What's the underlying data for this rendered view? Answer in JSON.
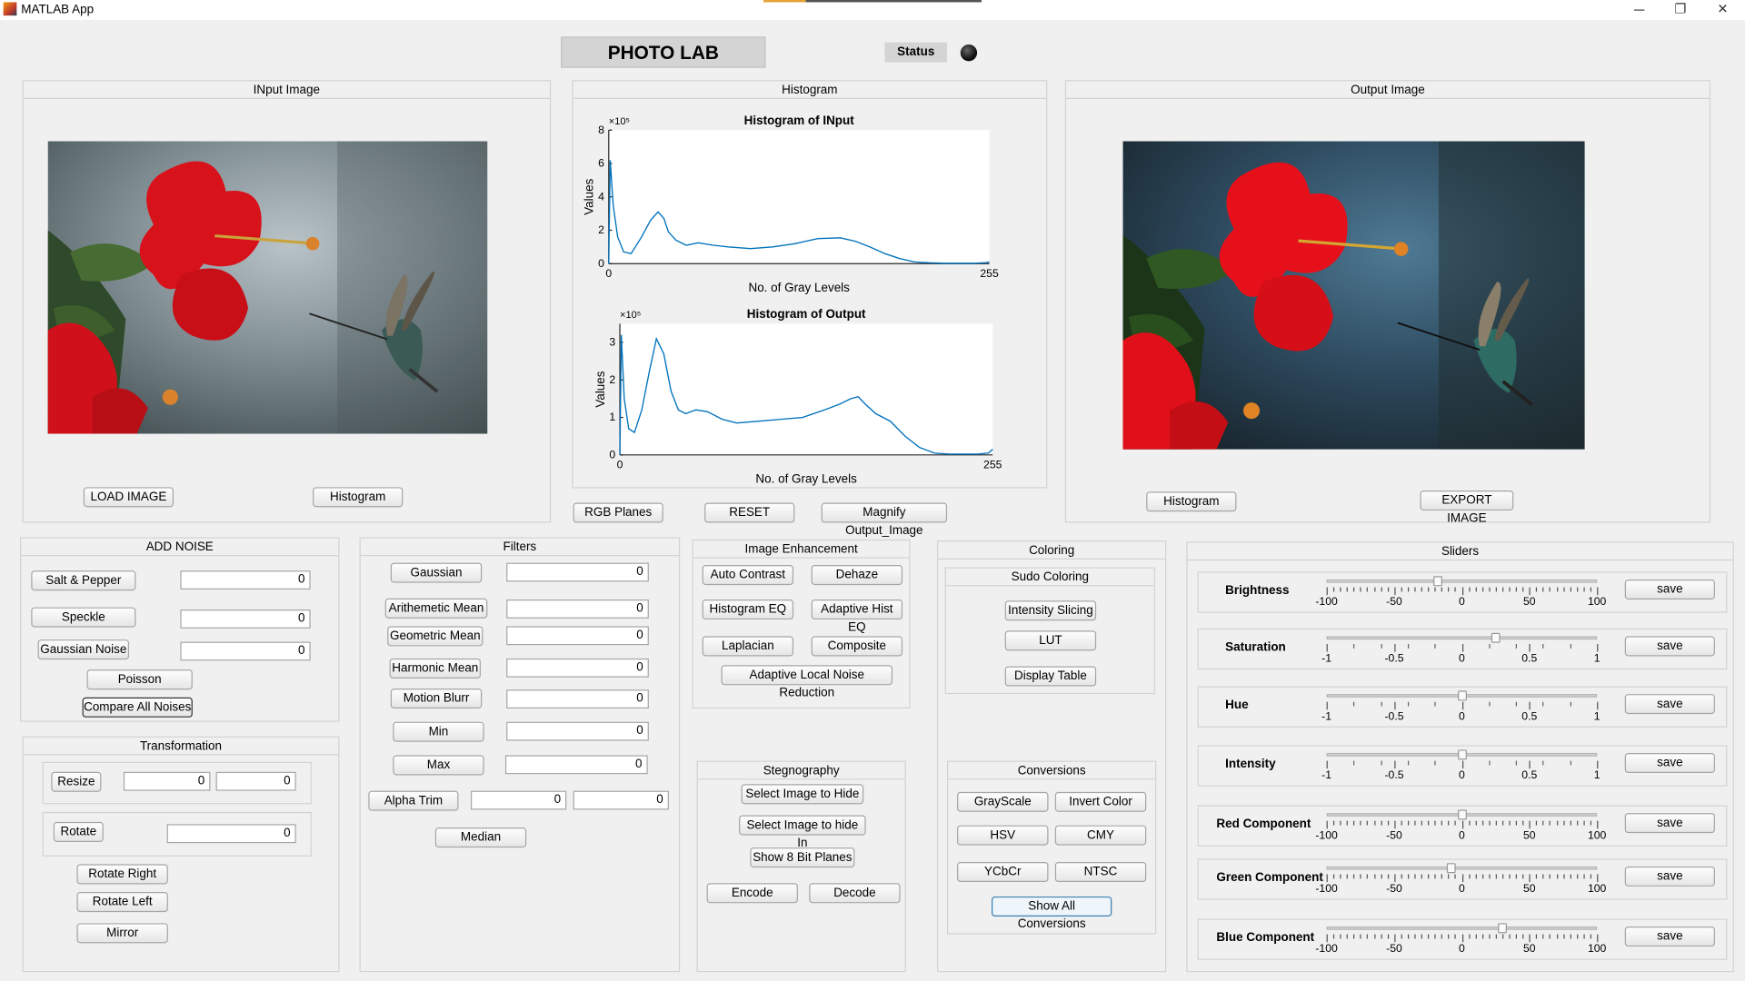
{
  "window": {
    "title": "MATLAB App",
    "minimize_glyph": "─",
    "maximize_glyph": "❐",
    "close_glyph": "✕"
  },
  "header": {
    "title": "PHOTO LAB",
    "status_label": "Status"
  },
  "input_panel": {
    "title": "INput Image",
    "load_button": "LOAD IMAGE",
    "histogram_button": "Histogram"
  },
  "output_panel": {
    "title": "Output Image",
    "histogram_button": "Histogram",
    "export_button": "EXPORT IMAGE"
  },
  "histogram_panel": {
    "title": "Histogram",
    "rgb_button": "RGB Planes",
    "reset_button": "RESET",
    "magnify_button": "Magnify Output_Image"
  },
  "chart_data": [
    {
      "type": "line",
      "title": "Histogram of INput",
      "xlabel": "No. of Gray Levels",
      "ylabel": "Values",
      "exponent_label": "×10⁵",
      "xlim": [
        0,
        255
      ],
      "ylim": [
        0,
        8
      ],
      "xticks": [
        "0",
        "255"
      ],
      "yticks": [
        "0",
        "2",
        "4",
        "6",
        "8"
      ],
      "series": [
        {
          "color": "#0072bd",
          "x": [
            0,
            1,
            3,
            6,
            10,
            15,
            22,
            28,
            33,
            37,
            40,
            45,
            52,
            60,
            70,
            80,
            95,
            110,
            125,
            140,
            155,
            165,
            175,
            185,
            195,
            205,
            215,
            225,
            235,
            245,
            252,
            255
          ],
          "y": [
            0,
            6.2,
            3.5,
            1.6,
            0.7,
            0.6,
            1.6,
            2.6,
            3.1,
            2.7,
            1.9,
            1.4,
            1.1,
            1.25,
            1.1,
            1.0,
            0.9,
            1.0,
            1.2,
            1.5,
            1.55,
            1.35,
            1.0,
            0.6,
            0.3,
            0.1,
            0.05,
            0.02,
            0.02,
            0.02,
            0.05,
            0.1
          ]
        }
      ]
    },
    {
      "type": "line",
      "title": "Histogram of Output",
      "xlabel": "No. of Gray Levels",
      "ylabel": "Values",
      "exponent_label": "×10⁵",
      "xlim": [
        0,
        255
      ],
      "ylim": [
        0,
        3.5
      ],
      "xticks": [
        "0",
        "255"
      ],
      "yticks": [
        "0",
        "1",
        "2",
        "3"
      ],
      "series": [
        {
          "color": "#0072bd",
          "x": [
            0,
            1,
            3,
            6,
            10,
            15,
            20,
            25,
            30,
            35,
            40,
            45,
            52,
            60,
            70,
            80,
            95,
            110,
            125,
            140,
            150,
            158,
            163,
            168,
            175,
            185,
            195,
            205,
            215,
            225,
            235,
            245,
            252,
            255
          ],
          "y": [
            0,
            3.2,
            1.5,
            0.7,
            0.6,
            1.2,
            2.2,
            3.1,
            2.7,
            1.7,
            1.2,
            1.1,
            1.2,
            1.15,
            0.95,
            0.85,
            0.9,
            0.95,
            1.0,
            1.2,
            1.35,
            1.5,
            1.55,
            1.35,
            1.1,
            0.9,
            0.5,
            0.2,
            0.05,
            0.02,
            0.02,
            0.02,
            0.05,
            0.15
          ]
        }
      ]
    }
  ],
  "add_noise": {
    "title": "ADD NOISE",
    "salt_pepper": "Salt & Pepper",
    "salt_pepper_value": "0",
    "speckle": "Speckle",
    "speckle_value": "0",
    "gaussian": "Gaussian Noise",
    "gaussian_value": "0",
    "poisson": "Poisson",
    "compare": "Compare All Noises"
  },
  "transformation": {
    "title": "Transformation",
    "resize": "Resize",
    "resize_w": "0",
    "resize_h": "0",
    "rotate": "Rotate",
    "rotate_value": "0",
    "rotate_right": "Rotate Right",
    "rotate_left": "Rotate Left",
    "mirror": "Mirror"
  },
  "filters": {
    "title": "Filters",
    "gaussian": "Gaussian",
    "gaussian_value": "0",
    "arith": "Arithemetic Mean",
    "arith_value": "0",
    "geo": "Geometric Mean",
    "geo_value": "0",
    "harm": "Harmonic Mean",
    "harm_value": "0",
    "motion": "Motion Blurr",
    "motion_value": "0",
    "min": "Min",
    "min_value": "0",
    "max": "Max",
    "max_value": "0",
    "alpha": "Alpha Trim",
    "alpha_value1": "0",
    "alpha_value2": "0",
    "median": "Median"
  },
  "enhancement": {
    "title": "Image Enhancement",
    "auto_contrast": "Auto Contrast",
    "dehaze": "Dehaze",
    "hist_eq": "Histogram EQ",
    "adapt_hist": "Adaptive Hist EQ",
    "laplacian": "Laplacian",
    "composite": "Composite",
    "adaptive_noise": "Adaptive Local Noise Reduction"
  },
  "steg": {
    "title": "Stegnography",
    "select_hide": "Select Image to Hide",
    "select_in": "Select Image to hide In",
    "show_planes": "Show 8 Bit Planes",
    "encode": "Encode",
    "decode": "Decode"
  },
  "coloring": {
    "title": "Coloring",
    "sudo_title": "Sudo Coloring",
    "intensity_slicing": "Intensity Slicing",
    "lut": "LUT",
    "display_table": "Display Table"
  },
  "conversions": {
    "title": "Conversions",
    "grayscale": "GrayScale",
    "invert": "Invert Color",
    "hsv": "HSV",
    "cmy": "CMY",
    "ycbcr": "YCbCr",
    "ntsc": "NTSC",
    "show_all": "Show All Conversions"
  },
  "sliders": {
    "title": "Sliders",
    "save_label": "save",
    "items": [
      {
        "label": "Brightness",
        "min": -100,
        "max": 100,
        "value": -18,
        "ticks": [
          "-100",
          "-50",
          "0",
          "50",
          "100"
        ],
        "minor": true
      },
      {
        "label": "Saturation",
        "min": -1,
        "max": 1,
        "value": 0.25,
        "ticks": [
          "-1",
          "-0.5",
          "0",
          "0.5",
          "1"
        ],
        "minor": false
      },
      {
        "label": "Hue",
        "min": -1,
        "max": 1,
        "value": 0,
        "ticks": [
          "-1",
          "-0.5",
          "0",
          "0.5",
          "1"
        ],
        "minor": false
      },
      {
        "label": "Intensity",
        "min": -1,
        "max": 1,
        "value": 0,
        "ticks": [
          "-1",
          "-0.5",
          "0",
          "0.5",
          "1"
        ],
        "minor": false
      },
      {
        "label": "Red Component",
        "min": -100,
        "max": 100,
        "value": 0,
        "ticks": [
          "-100",
          "-50",
          "0",
          "50",
          "100"
        ],
        "minor": true
      },
      {
        "label": "Green Component",
        "min": -100,
        "max": 100,
        "value": -8,
        "ticks": [
          "-100",
          "-50",
          "0",
          "50",
          "100"
        ],
        "minor": true
      },
      {
        "label": "Blue Component",
        "min": -100,
        "max": 100,
        "value": 30,
        "ticks": [
          "-100",
          "-50",
          "0",
          "50",
          "100"
        ],
        "minor": true
      }
    ]
  },
  "colors": {
    "accent": "#0072bd",
    "status_lamp": "#1a1a1a",
    "title_bg": "#d4d4d4"
  }
}
